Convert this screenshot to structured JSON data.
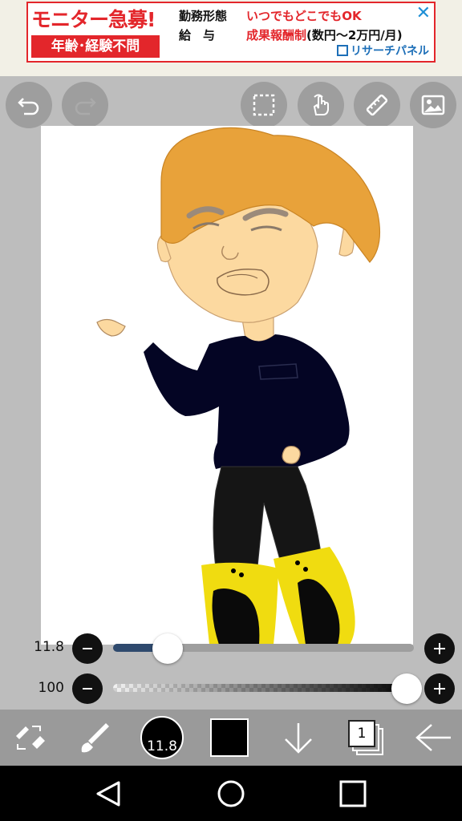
{
  "ad": {
    "title": "モニター急募!",
    "badge": "年齢･経験不問",
    "row1_key": "勤務形態",
    "row1_val": "いつでもどこでもOK",
    "row2_key": "給　与",
    "row2_val": "成果報酬制",
    "row2_extra": "(数円〜2万円/月)",
    "brand": "リサーチパネル",
    "close": "✕"
  },
  "toolbar": {
    "icons": [
      "undo-icon",
      "redo-icon",
      "selection-icon",
      "hand-icon",
      "ruler-icon",
      "image-icon"
    ]
  },
  "sliders": {
    "size": {
      "label": "11.8",
      "value": 11.8,
      "fill_fraction": 0.18,
      "color": "#2f4a6e"
    },
    "opacity": {
      "label": "100",
      "value": 100,
      "fill_fraction": 1.0
    }
  },
  "bottombar": {
    "brush_size": "11.8",
    "current_color": "#000000",
    "layer_count": "1"
  },
  "colors": {
    "background": "#bdbdbd",
    "ad_red": "#e3262b",
    "hair": "#e8a23a",
    "skin": "#fcd9a0",
    "sweater": "#040524",
    "pants": "#111111",
    "boots": "#f0dc10"
  }
}
